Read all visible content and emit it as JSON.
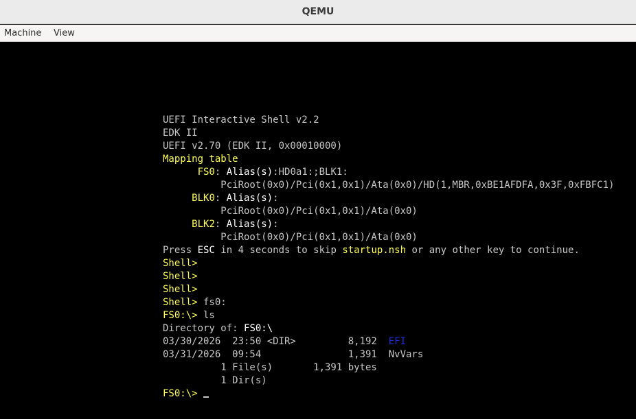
{
  "window": {
    "title": "QEMU"
  },
  "menubar": {
    "items": [
      {
        "label": "Machine"
      },
      {
        "label": "View"
      }
    ]
  },
  "console": {
    "lines": [
      [
        {
          "t": "UEFI Interactive Shell v2.2",
          "c": "g"
        }
      ],
      [
        {
          "t": "EDK II",
          "c": "g"
        }
      ],
      [
        {
          "t": "UEFI v2.70 (EDK II, 0x00010000)",
          "c": "g"
        }
      ],
      [
        {
          "t": "Mapping table",
          "c": "y"
        }
      ],
      [
        {
          "t": "      ",
          "c": "g"
        },
        {
          "t": "FS0",
          "c": "y"
        },
        {
          "t": ": ",
          "c": "g"
        },
        {
          "t": "Alias(s)",
          "c": "w"
        },
        {
          "t": ":HD0a1:;BLK1:",
          "c": "g"
        }
      ],
      [
        {
          "t": "          PciRoot(0x0)/Pci(0x1,0x1)/Ata(0x0)/HD(1,MBR,0xBE1AFDFA,0x3F,0xFBFC1)",
          "c": "g"
        }
      ],
      [
        {
          "t": "     ",
          "c": "g"
        },
        {
          "t": "BLK0",
          "c": "y"
        },
        {
          "t": ": ",
          "c": "g"
        },
        {
          "t": "Alias(s)",
          "c": "w"
        },
        {
          "t": ":",
          "c": "g"
        }
      ],
      [
        {
          "t": "          PciRoot(0x0)/Pci(0x1,0x1)/Ata(0x0)",
          "c": "g"
        }
      ],
      [
        {
          "t": "     ",
          "c": "g"
        },
        {
          "t": "BLK2",
          "c": "y"
        },
        {
          "t": ": ",
          "c": "g"
        },
        {
          "t": "Alias(s)",
          "c": "w"
        },
        {
          "t": ":",
          "c": "g"
        }
      ],
      [
        {
          "t": "          PciRoot(0x0)/Pci(0x1,0x1)/Ata(0x0)",
          "c": "g"
        }
      ],
      [
        {
          "t": "Press ",
          "c": "g"
        },
        {
          "t": "ESC",
          "c": "w"
        },
        {
          "t": " in 4 seconds to skip ",
          "c": "g"
        },
        {
          "t": "startup.nsh",
          "c": "y"
        },
        {
          "t": " or any other key to continue.",
          "c": "g"
        }
      ],
      [
        {
          "t": "Shell>",
          "c": "y"
        }
      ],
      [
        {
          "t": "Shell>",
          "c": "y"
        }
      ],
      [
        {
          "t": "Shell>",
          "c": "y"
        }
      ],
      [
        {
          "t": "Shell>",
          "c": "y"
        },
        {
          "t": " fs0:",
          "c": "g"
        }
      ],
      [
        {
          "t": "FS0:\\>",
          "c": "y"
        },
        {
          "t": " ls",
          "c": "g"
        }
      ],
      [
        {
          "t": "Directory of: ",
          "c": "g"
        },
        {
          "t": "FS0:\\",
          "c": "w"
        }
      ],
      [
        {
          "t": "03/30/2026  23:50 <DIR>         8,192  ",
          "c": "g"
        },
        {
          "t": "EFI",
          "c": "b"
        }
      ],
      [
        {
          "t": "03/31/2026  09:54               1,391  NvVars",
          "c": "g"
        }
      ],
      [
        {
          "t": "          1 File(s)       1,391 bytes",
          "c": "g"
        }
      ],
      [
        {
          "t": "          1 Dir(s)",
          "c": "g"
        }
      ],
      [
        {
          "t": "FS0:\\>",
          "c": "y"
        },
        {
          "t": " ",
          "c": "g"
        }
      ]
    ]
  }
}
